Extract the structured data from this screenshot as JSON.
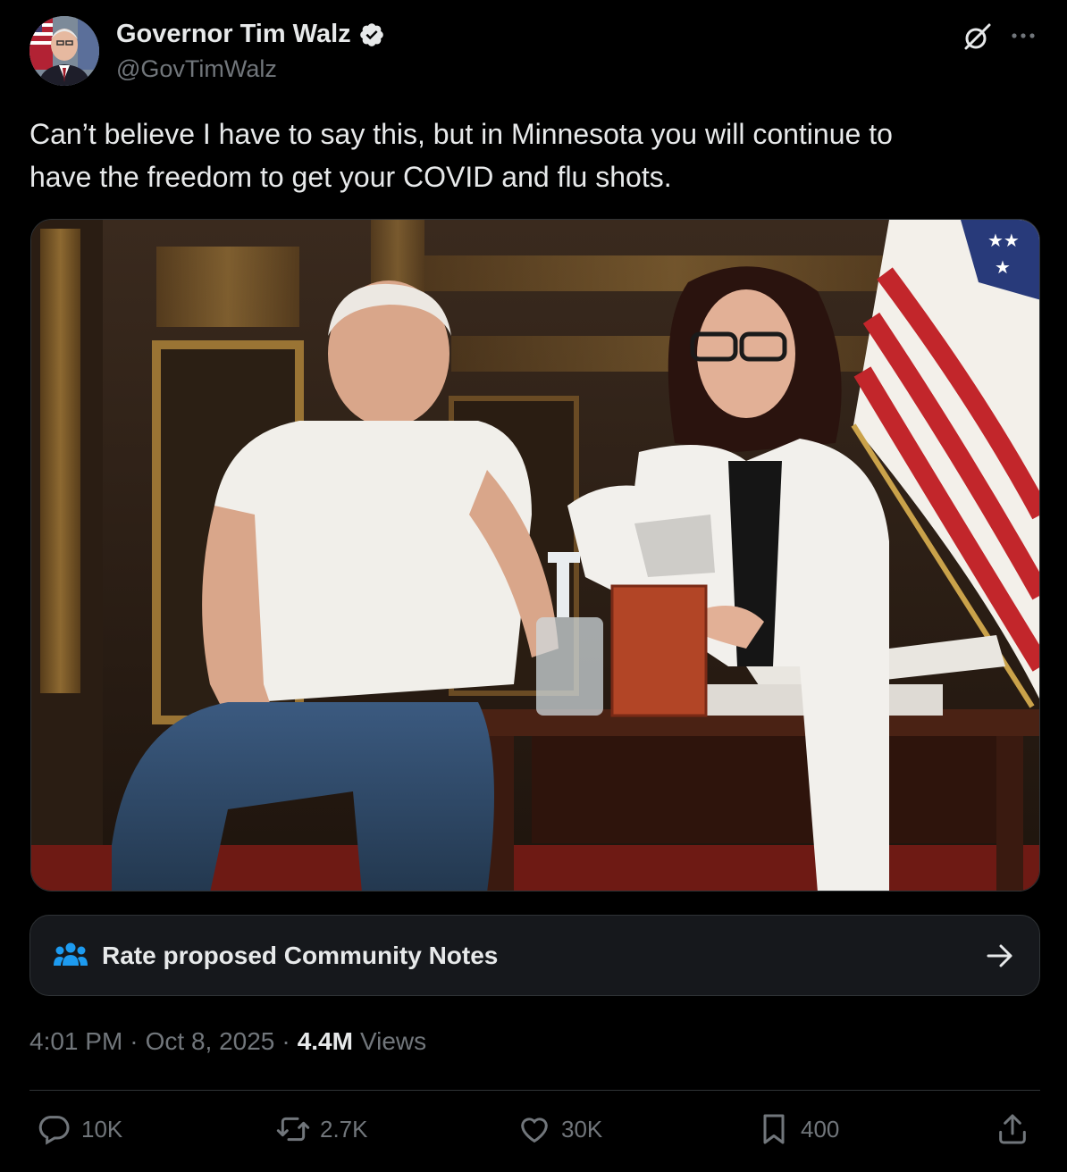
{
  "author": {
    "name": "Governor Tim Walz",
    "handle": "@GovTimWalz"
  },
  "tweet": {
    "text": "Can’t believe I have to say this, but in Minnesota you will continue to\nhave the freedom to get your COVID and flu shots."
  },
  "community_notes": {
    "label": "Rate proposed Community Notes"
  },
  "meta": {
    "time": "4:01 PM",
    "date": "Oct 8, 2025",
    "views_count": "4.4M",
    "views_label": "Views",
    "separator": "·"
  },
  "actions": {
    "replies": "10K",
    "reposts": "2.7K",
    "likes": "30K",
    "bookmarks": "400"
  },
  "colors": {
    "background": "#000000",
    "text": "#e7e9ea",
    "muted": "#71767b",
    "verified": "#1d9bf0",
    "border": "#2f3336"
  },
  "icons": [
    "verified-badge-icon",
    "grok-icon",
    "more-icon",
    "community-notes-icon",
    "arrow-right-icon",
    "reply-icon",
    "repost-icon",
    "like-icon",
    "bookmark-icon",
    "share-icon"
  ]
}
